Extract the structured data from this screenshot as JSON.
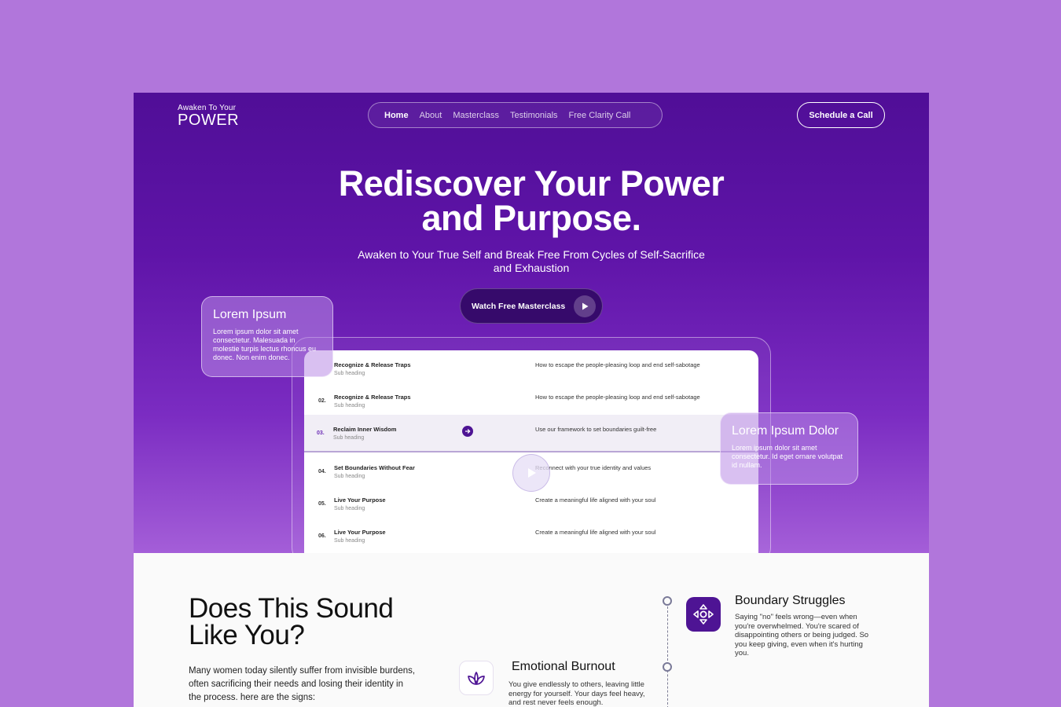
{
  "colors": {
    "page_bg": "#b176db",
    "hero_dark": "#500e97",
    "hero_light": "#a45ed8",
    "accent": "#4e1494",
    "button_dark": "#360a6b"
  },
  "logo": {
    "small": "Awaken To Your",
    "big": "POWER"
  },
  "nav": {
    "items": [
      "Home",
      "About",
      "Masterclass",
      "Testimonials",
      "Free Clarity Call"
    ],
    "cta": "Schedule a Call"
  },
  "hero": {
    "title_line1": "Rediscover Your Power",
    "title_line2": "and Purpose.",
    "subtitle_line1": "Awaken to Your True Self and Break Free From Cycles of Self-Sacrifice",
    "subtitle_line2": "and Exhaustion",
    "watch_button": "Watch Free Masterclass"
  },
  "cards": {
    "left": {
      "title": "Lorem Ipsum",
      "text": "Lorem ipsum dolor sit amet consectetur. Malesuada in molestie turpis lectus rhoncus eu donec. Non enim donec."
    },
    "right": {
      "title": "Lorem Ipsum Dolor",
      "text": "Lorem ipsum dolor sit amet consectetur. Id eget ornare volutpat id nullam."
    }
  },
  "modules": [
    {
      "num": "",
      "title": "Recognize & Release Traps",
      "sub": "Sub heading",
      "desc": "How to escape the people-pleasing loop and end self-sabotage"
    },
    {
      "num": "02.",
      "title": "Recognize & Release Traps",
      "sub": "Sub heading",
      "desc": "How to escape the people-pleasing loop and end self-sabotage"
    },
    {
      "num": "03.",
      "title": "Reclaim Inner Wisdom",
      "sub": "Sub heading",
      "desc": "Use our framework to set boundaries guilt-free"
    },
    {
      "num": "04.",
      "title": "Set Boundaries Without Fear",
      "sub": "Sub heading",
      "desc": "Reconnect with your true identity and values"
    },
    {
      "num": "05.",
      "title": "Live Your Purpose",
      "sub": "Sub heading",
      "desc": "Create a meaningful life aligned with your soul"
    },
    {
      "num": "06.",
      "title": "Live Your Purpose",
      "sub": "Sub heading",
      "desc": "Create a meaningful life aligned with your soul"
    }
  ],
  "section": {
    "title_line1": "Does This Sound",
    "title_line2": "Like You?",
    "text": "Many women today silently suffer from invisible burdens, often sacrificing their needs and losing their identity in the process. here are the signs:"
  },
  "features": [
    {
      "icon": "directions-icon",
      "title": "Boundary Struggles",
      "text": "Saying \"no\" feels wrong—even when you're overwhelmed. You're scared of disappointing others or being judged. So you keep giving, even when it's hurting you."
    },
    {
      "icon": "leaf-icon",
      "title": "Emotional Burnout",
      "text": "You give endlessly to others, leaving little energy for yourself. Your days feel heavy, and rest never feels enough."
    }
  ]
}
